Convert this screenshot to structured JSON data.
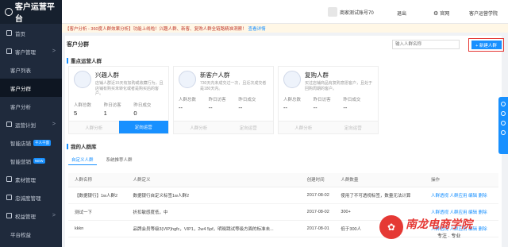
{
  "sidebar": {
    "logo": "客户运营平台",
    "items": [
      {
        "label": "首页",
        "icon": "home-icon",
        "chev": ""
      },
      {
        "label": "客户管理",
        "icon": "people-icon",
        "chev": ">"
      },
      {
        "label": "客户列表",
        "sub": true
      },
      {
        "label": "客户分群",
        "sub": true,
        "active": true
      },
      {
        "label": "客户分析",
        "sub": true
      },
      {
        "label": "运营计划",
        "icon": "plan-icon",
        "chev": ">"
      },
      {
        "label": "智能店铺",
        "sub": true,
        "badge": "千人千面"
      },
      {
        "label": "智能营销",
        "sub": true,
        "badge": "NEW"
      },
      {
        "label": "素材管理",
        "icon": "material-icon",
        "chev": ""
      },
      {
        "label": "忠诚度管理",
        "icon": "loyalty-icon",
        "chev": ""
      },
      {
        "label": "权益管理",
        "icon": "rights-icon",
        "chev": ">"
      },
      {
        "label": "平台权益",
        "sub": true
      }
    ]
  },
  "topbar": {
    "account": "商家测试账号70",
    "logout": "退出",
    "official": "官网",
    "academy": "客户运营学院"
  },
  "notice": {
    "text": "【客户分析 - 360度人群效果分析】功能上线啦！兴趣人群、新客、复购人群全链路精准洞察！",
    "link": "查看详情"
  },
  "page": {
    "title": "客户分群",
    "search_placeholder": "输入人群名称",
    "new_button": "+ 新建人群",
    "section_key": "重点运营人群",
    "section_mine": "我的人群库"
  },
  "personas": [
    {
      "name": "兴趣人群",
      "desc": "店铺人群近15天有加购或收藏行为，且店铺有购买未转化或者是购买后的客户。",
      "labels": [
        "人群总数",
        "昨日访客",
        "昨日成交"
      ],
      "values": [
        "5",
        "1",
        "0"
      ],
      "btn1": "人群分析",
      "btn2": "定向运营",
      "btn2_primary": true
    },
    {
      "name": "新客户人群",
      "desc": "730天内未成交过一次，且近次成交者是180天内。",
      "labels": [
        "人群总数",
        "昨日访客",
        "昨日成交"
      ],
      "values": [
        "--",
        "--",
        "--"
      ],
      "btn1": "人群分析",
      "btn2": "定向运营",
      "btn2_primary": false
    },
    {
      "name": "复购人群",
      "desc": "买过店铺商品有复购意愿客户，且处于回购周期的客户。",
      "labels": [
        "人群总数",
        "昨日访客",
        "昨日成交"
      ],
      "values": [
        "--",
        "--",
        "--"
      ],
      "btn1": "人群分析",
      "btn2": "定向运营",
      "btn2_primary": false
    }
  ],
  "tabs": [
    "自定义人群",
    "系统推荐人群"
  ],
  "table": {
    "headers": [
      "人群名称",
      "人群定义",
      "创建时间",
      "人群数量",
      "操作"
    ],
    "rows": [
      [
        "【数据银行】1w人群2",
        "数据银行自定义标签1w人群2",
        "2017-08-02",
        "使用了不可透视标签，数量无法计算",
        "人群透视 人群应用 编辑 删除"
      ],
      [
        "测试一下",
        "折扣敏感度低，中",
        "2017-08-02",
        "300+",
        "人群透视 人群应用 编辑 删除"
      ],
      [
        "kkkn",
        "品牌会员等级3(VIP)hgfc，VIP1，2w4 5pf，明晓跳试等级方面的标准未...",
        "2017-08-01",
        "低于300人",
        "人群透视 人群应用 编辑 删除"
      ]
    ]
  },
  "watermark": {
    "text": "南龙电商学院",
    "sub": "专注 · 专业"
  },
  "colors": {
    "accent": "#1890ff",
    "sidebar_bg": "#1f2a3c",
    "highlight_red": "#e53935"
  }
}
